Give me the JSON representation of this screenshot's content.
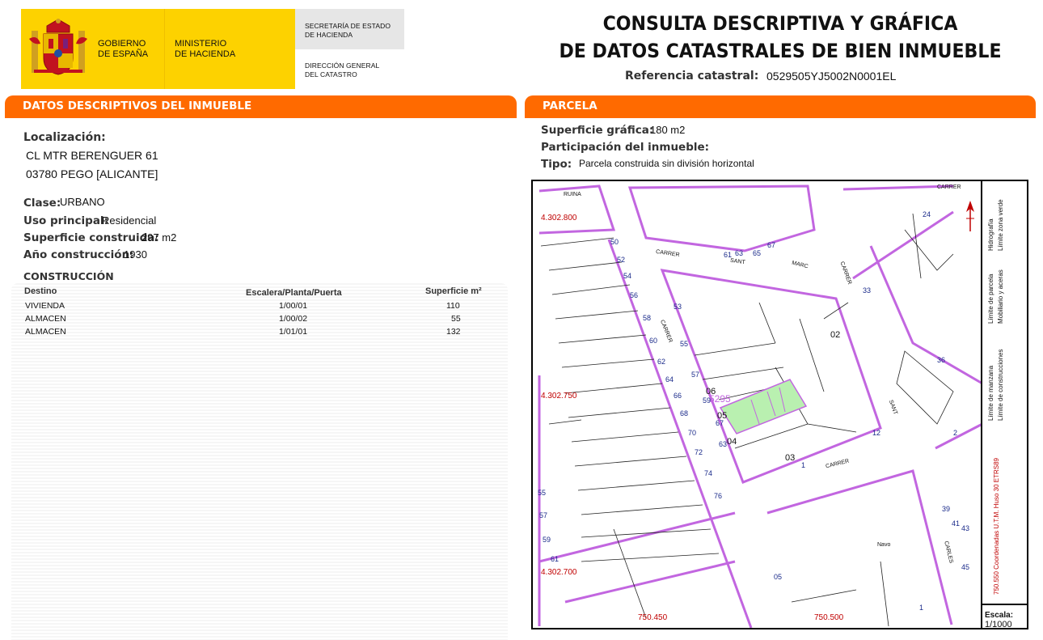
{
  "header": {
    "gov_line1": "GOBIERNO",
    "gov_line2": "DE ESPAÑA",
    "ministry_line1": "MINISTERIO",
    "ministry_line2": "DE HACIENDA",
    "secretaria_line1": "SECRETARÍA DE ESTADO",
    "secretaria_line2": "DE HACIENDA",
    "direccion_line1": "DIRECCIÓN GENERAL",
    "direccion_line2": "DEL CATASTRO",
    "title_line1": "CONSULTA DESCRIPTIVA Y GRÁFICA",
    "title_line2": "DE DATOS CATASTRALES DE BIEN INMUEBLE",
    "ref_label": "Referencia catastral:",
    "ref_value": "0529505YJ5002N0001EL"
  },
  "colors": {
    "accent": "#ff6a00",
    "brand_yellow": "#fdd200",
    "parcel_line": "#c266e0",
    "parcel_fill": "#b9f0b0",
    "coord_red": "#c00000"
  },
  "descriptivos": {
    "section_title": "DATOS DESCRIPTIVOS DEL INMUEBLE",
    "localizacion_label": "Localización:",
    "address_line1": "CL MTR BERENGUER 61",
    "address_line2": "03780 PEGO [ALICANTE]",
    "clase_label": "Clase:",
    "clase_value": "URBANO",
    "uso_label": "Uso principal:",
    "uso_value": "Residencial",
    "superficie_label": "Superficie construida:",
    "superficie_value": "297 m2",
    "anio_label": "Año construcción:",
    "anio_value": "1930"
  },
  "construccion": {
    "title": "CONSTRUCCIÓN",
    "headers": [
      "Destino",
      "Escalera/Planta/Puerta",
      "Superficie m²"
    ],
    "rows": [
      [
        "VIVIENDA",
        "1/00/01",
        "110"
      ],
      [
        "ALMACEN",
        "1/00/02",
        "55"
      ],
      [
        "ALMACEN",
        "1/01/01",
        "132"
      ]
    ]
  },
  "parcela": {
    "section_title": "PARCELA",
    "superficie_label": "Superficie gráfica:",
    "superficie_value": "180 m2",
    "participacion_label": "Participación del inmueble:",
    "tipo_label": "Tipo:",
    "tipo_value": "Parcela construida sin división horizontal"
  },
  "map": {
    "coords": {
      "n_top": "4.302.800",
      "n_mid": "4.302.750",
      "n_bot": "4.302.700",
      "e_left": "750.450",
      "e_right": "750.500"
    },
    "streets": [
      "RUINA",
      "CARRER",
      "SANT",
      "MARC",
      "CARRER",
      "CARRER",
      "CARRER",
      "SANT",
      "CARRER",
      "CARLES",
      "Navo"
    ],
    "parcel_codes": [
      "02",
      "03",
      "04",
      "05",
      "06",
      "5295"
    ],
    "house_numbers": [
      "61",
      "63",
      "65",
      "67",
      "24",
      "33",
      "36",
      "50",
      "52",
      "54",
      "56",
      "58",
      "60",
      "62",
      "64",
      "66",
      "68",
      "70",
      "72",
      "74",
      "76",
      "53",
      "55",
      "57",
      "59",
      "63",
      "67",
      "12",
      "2",
      "1",
      "55",
      "57",
      "59",
      "61",
      "05",
      "43",
      "45",
      "41",
      "39",
      "1"
    ],
    "legend": {
      "limite_manzana": "Límite de manzana",
      "limite_parcela": "Límite de parcela",
      "hidrografia": "Hidrografía",
      "limite_construcciones": "Límite de construcciones",
      "mobiliario": "Mobiliario y aceras",
      "limite_zona_verde": "Límite zona verde",
      "coordinates_note": "750.550 Coordenadas U.T.M. Huso 30 ETRS89",
      "escala_label": "Escala:",
      "escala_value": "1/1000"
    }
  }
}
